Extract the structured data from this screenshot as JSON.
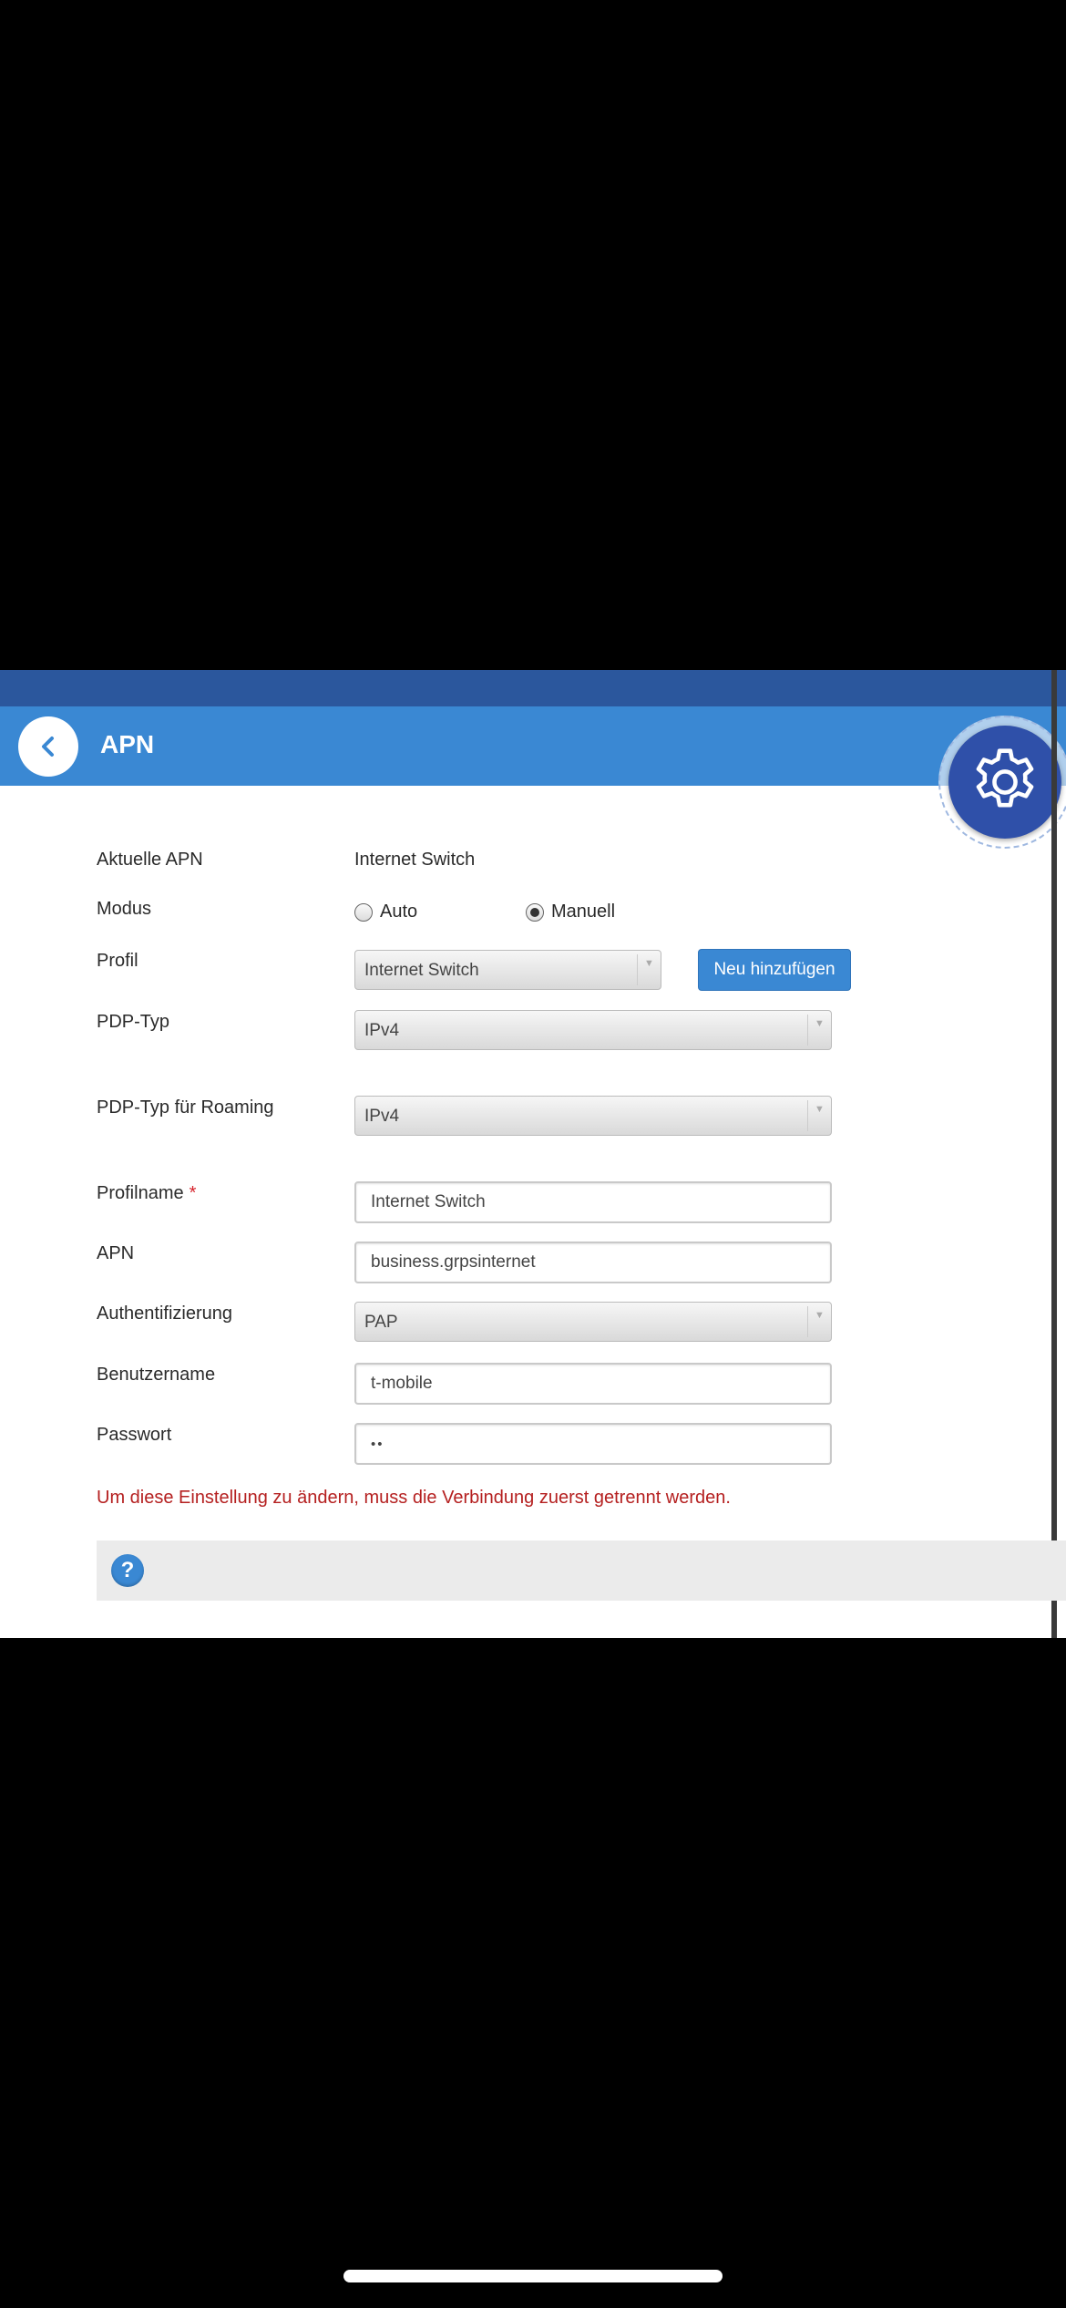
{
  "header": {
    "title": "APN"
  },
  "form": {
    "current_apn_label": "Aktuelle APN",
    "current_apn_value": "Internet Switch",
    "mode_label": "Modus",
    "mode_auto": "Auto",
    "mode_manual": "Manuell",
    "mode_selected": "Manuell",
    "profile_label": "Profil",
    "profile_value": "Internet Switch",
    "add_button": "Neu hinzufügen",
    "pdp_type_label": "PDP-Typ",
    "pdp_type_value": "IPv4",
    "pdp_roaming_label": "PDP-Typ für Roaming",
    "pdp_roaming_value": "IPv4",
    "profile_name_label": "Profilname",
    "required_marker": "*",
    "profile_name_value": "Internet Switch",
    "apn_label": "APN",
    "apn_value": "business.grpsinternet",
    "auth_label": "Authentifizierung",
    "auth_value": "PAP",
    "username_label": "Benutzername",
    "username_value": "t-mobile",
    "password_label": "Passwort",
    "password_value": "••"
  },
  "warning": "Um diese Einstellung zu ändern, muss die Verbindung zuerst getrennt werden.",
  "help": {
    "icon_glyph": "?"
  },
  "icons": {
    "back": "chevron-left-icon",
    "settings": "gear-icon",
    "help": "help-icon",
    "dropdown": "chevron-down-icon"
  },
  "colors": {
    "header": "#3a88d3",
    "status_bar": "#2b579d",
    "gear_button": "#2f50a9",
    "warning": "#b52020",
    "required": "#d6232c"
  }
}
